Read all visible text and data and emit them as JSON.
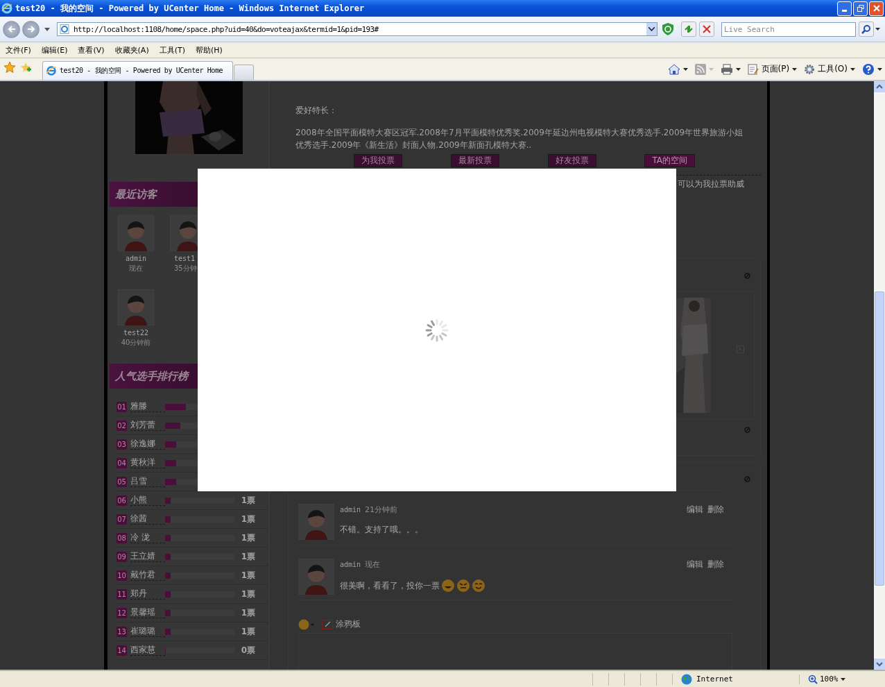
{
  "window": {
    "title": "test20 - 我的空间 - Powered by UCenter Home - Windows Internet Explorer"
  },
  "address_bar": {
    "url": "http://localhost:1108/home/space.php?uid=40&do=voteajax&termid=1&pid=193#"
  },
  "search": {
    "placeholder": "Live Search"
  },
  "menu": [
    "文件(F)",
    "编辑(E)",
    "查看(V)",
    "收藏夹(A)",
    "工具(T)",
    "帮助(H)"
  ],
  "tabs": [
    {
      "label": "test20 - 我的空间 - Powered by UCenter Home",
      "selected": true
    }
  ],
  "command_bar": [
    {
      "kind": "home"
    },
    {
      "kind": "feeds"
    },
    {
      "kind": "print"
    },
    {
      "kind": "page",
      "label": "页面(P)"
    },
    {
      "kind": "tools",
      "label": "工具(O)"
    },
    {
      "kind": "help"
    }
  ],
  "page": {
    "visitors_title": "最近访客",
    "visitors": [
      {
        "name": "admin",
        "time": "现在"
      },
      {
        "name": "test1",
        "time": "35分钟"
      },
      {
        "name": "test22",
        "time": "40分钟前"
      }
    ],
    "ranking_title": "人气选手排行榜",
    "ranking": [
      {
        "rank": "01",
        "name": "雅滕",
        "level": 0.3
      },
      {
        "rank": "02",
        "name": "刘芳蕾",
        "level": 0.22
      },
      {
        "rank": "03",
        "name": "徐逸娜",
        "level": 0.16
      },
      {
        "rank": "04",
        "name": "黄秋洋",
        "level": 0.16
      },
      {
        "rank": "05",
        "name": "吕雪",
        "level": 0.16
      },
      {
        "rank": "06",
        "name": "小熊",
        "level": 0.08,
        "votes": "1票"
      },
      {
        "rank": "07",
        "name": "徐茜",
        "level": 0.08,
        "votes": "1票"
      },
      {
        "rank": "08",
        "name": "冷 泷",
        "level": 0.08,
        "votes": "1票"
      },
      {
        "rank": "09",
        "name": "王立婧",
        "level": 0.08,
        "votes": "1票"
      },
      {
        "rank": "10",
        "name": "戴竹君",
        "level": 0.08,
        "votes": "1票"
      },
      {
        "rank": "11",
        "name": "郑丹",
        "level": 0.08,
        "votes": "1票"
      },
      {
        "rank": "12",
        "name": "景馨瑶",
        "level": 0.08,
        "votes": "1票"
      },
      {
        "rank": "13",
        "name": "崔璐璐",
        "level": 0.08,
        "votes": "1票"
      },
      {
        "rank": "14",
        "name": "西家慧",
        "level": 0.01,
        "votes": "0票"
      }
    ],
    "hobby_label": "爱好特长：",
    "hobby_text": "2008年全国平面模特大赛区冠军.2008年7月平面模特优秀奖.2009年延边州电视模特大赛优秀选手.2009年世界旅游小姐优秀选手.2009年《新生活》封面人物.2009年新面孔模特大赛..",
    "actions": [
      "为我投票",
      "最新投票",
      "好友投票",
      "TA的空间"
    ],
    "invite_note": "可以为我拉票助威",
    "comments": [
      {
        "author": "admin",
        "time": "21分钟前",
        "edit": "编辑",
        "delete": "删除",
        "text": "不错。支持了哦。。。"
      },
      {
        "author": "admin",
        "time": "现在",
        "edit": "编辑",
        "delete": "删除",
        "text": "很美啊，看看了，投你一票",
        "emoticons": [
          {
            "kind": "grin"
          },
          {
            "kind": "smirk"
          },
          {
            "kind": "laugh"
          }
        ]
      }
    ],
    "composer": {
      "doodle": "涂鸦板"
    }
  },
  "status_bar": {
    "zone": "Internet",
    "zoom": "100%"
  }
}
